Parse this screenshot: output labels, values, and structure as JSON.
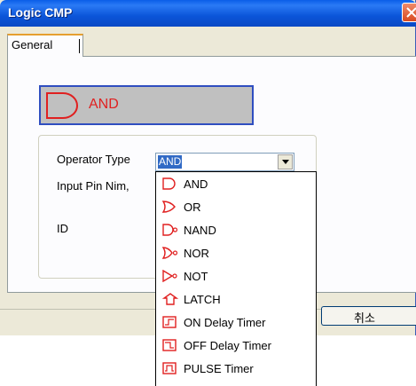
{
  "window": {
    "title": "Logic CMP"
  },
  "tabs": [
    {
      "label": "General"
    }
  ],
  "preview": {
    "label": "AND"
  },
  "form": {
    "operator_type_label": "Operator Type",
    "input_pin_label": "Input Pin Nim,",
    "id_label": "ID",
    "operator_type_value": "AND"
  },
  "buttons": {
    "cancel": "취소"
  },
  "dropdown": {
    "items": [
      {
        "label": "AND",
        "icon": "and-gate-icon"
      },
      {
        "label": "OR",
        "icon": "or-gate-icon"
      },
      {
        "label": "NAND",
        "icon": "nand-gate-icon"
      },
      {
        "label": "NOR",
        "icon": "nor-gate-icon"
      },
      {
        "label": "NOT",
        "icon": "not-gate-icon"
      },
      {
        "label": "LATCH",
        "icon": "latch-icon"
      },
      {
        "label": "ON Delay Timer",
        "icon": "on-delay-timer-icon"
      },
      {
        "label": "OFF Delay Timer",
        "icon": "off-delay-timer-icon"
      },
      {
        "label": "PULSE Timer",
        "icon": "pulse-timer-icon"
      }
    ]
  },
  "colors": {
    "titlebar": "#0a5ee8",
    "gate_red": "#e02020",
    "selection": "#316ac5",
    "preview_bg": "#c0c0c0"
  }
}
